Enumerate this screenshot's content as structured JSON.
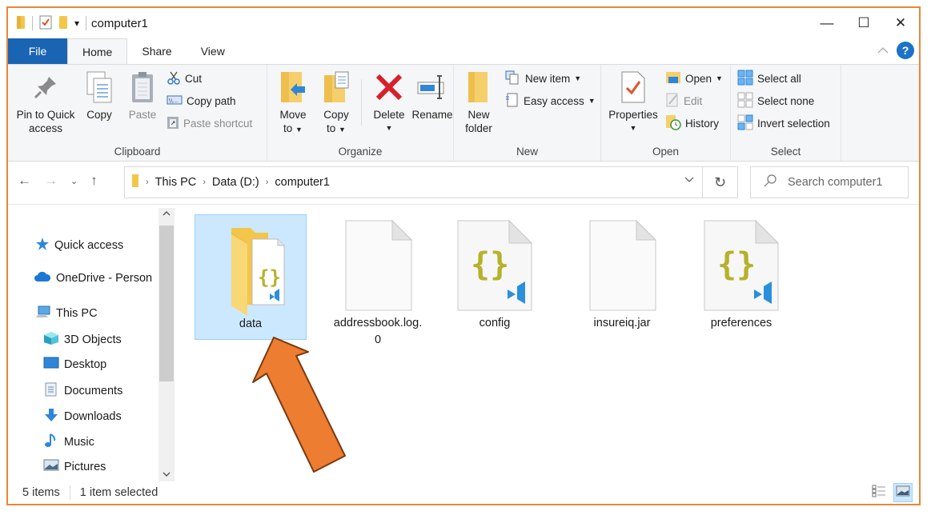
{
  "window": {
    "title": "computer1",
    "controls": {
      "minimize": "—",
      "maximize": "☐",
      "close": "✕"
    },
    "qat_dropdown": "▾"
  },
  "tabs": [
    {
      "label": "File"
    },
    {
      "label": "Home"
    },
    {
      "label": "Share"
    },
    {
      "label": "View"
    }
  ],
  "ribbon_help": "?",
  "ribbon_collapse": "^",
  "ribbon": {
    "clipboard": {
      "label": "Clipboard",
      "pin": "Pin to Quick access",
      "pin_l1": "Pin to Quick",
      "pin_l2": "access",
      "copy": "Copy",
      "paste": "Paste",
      "cut": "Cut",
      "copy_path": "Copy path",
      "paste_shortcut": "Paste shortcut"
    },
    "organize": {
      "label": "Organize",
      "move_l1": "Move",
      "move_l2": "to",
      "copy_l1": "Copy",
      "copy_l2": "to",
      "delete": "Delete",
      "rename": "Rename"
    },
    "new": {
      "label": "New",
      "folder_l1": "New",
      "folder_l2": "folder",
      "new_item": "New item",
      "easy_access": "Easy access"
    },
    "open": {
      "label": "Open",
      "properties": "Properties",
      "open": "Open",
      "edit": "Edit",
      "history": "History"
    },
    "select": {
      "label": "Select",
      "select_all": "Select all",
      "select_none": "Select none",
      "invert": "Invert selection"
    }
  },
  "address": {
    "crumbs": [
      "This PC",
      "Data (D:)",
      "computer1"
    ],
    "search_placeholder": "Search computer1"
  },
  "navpane": {
    "items": [
      {
        "label": "Quick access",
        "icon": "star-icon"
      },
      {
        "label": "OneDrive - Person",
        "icon": "cloud-icon"
      },
      {
        "label": "This PC",
        "icon": "computer-icon"
      },
      {
        "label": "3D Objects",
        "icon": "cube-icon"
      },
      {
        "label": "Desktop",
        "icon": "desktop-icon"
      },
      {
        "label": "Documents",
        "icon": "document-icon"
      },
      {
        "label": "Downloads",
        "icon": "download-icon"
      },
      {
        "label": "Music",
        "icon": "music-icon"
      },
      {
        "label": "Pictures",
        "icon": "pictures-icon"
      }
    ]
  },
  "files": [
    {
      "name": "data",
      "type": "folder",
      "selected": true
    },
    {
      "name": "addressbook.log.0",
      "name_l1": "addressbook.log.",
      "name_l2": "0",
      "type": "file"
    },
    {
      "name": "config",
      "type": "json"
    },
    {
      "name": "insureiq.jar",
      "type": "file"
    },
    {
      "name": "preferences",
      "type": "json"
    }
  ],
  "status": {
    "count": "5 items",
    "selection": "1 item selected"
  },
  "colors": {
    "accent": "#1a64b4",
    "selection": "#cce8ff",
    "annotation_arrow": "#ed7d31",
    "border": "#e8883a"
  }
}
